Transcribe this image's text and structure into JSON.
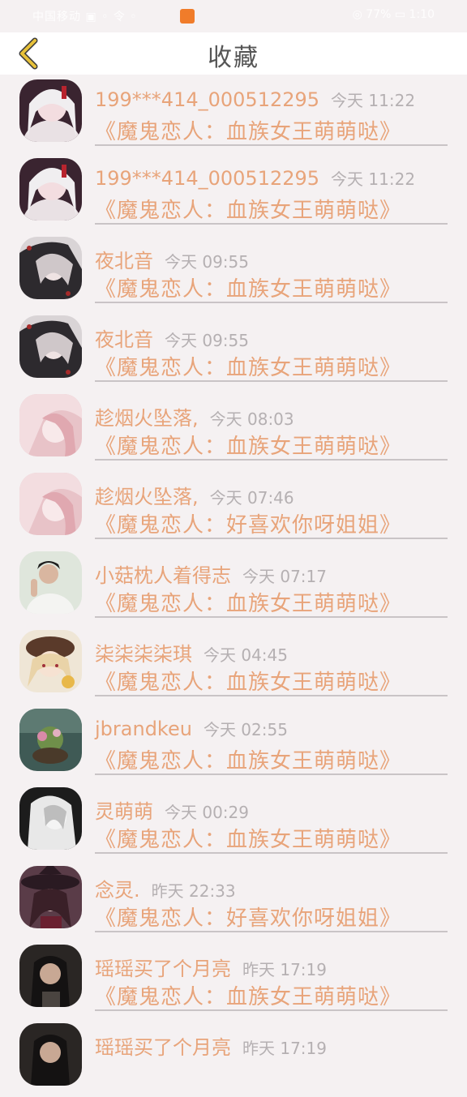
{
  "status_bar": {
    "left_text": "中国移动 ▣ ◦ 令 ◦",
    "right_text": "◎ 77% ▭ 1:10"
  },
  "header": {
    "title": "收藏",
    "back_icon": "chevron-left-icon"
  },
  "colors": {
    "accent": "#e8a47a",
    "back_icon": "#e7c13a",
    "time": "#b5b0b2",
    "divider": "#c9c4c6"
  },
  "items": [
    {
      "name": "199***414_000512295",
      "time": "今天 11:22",
      "title": "《魔鬼恋人：血族女王萌萌哒》",
      "avatar": "girl-white-hair-avatar"
    },
    {
      "name": "199***414_000512295",
      "time": "今天 11:22",
      "title": "《魔鬼恋人：血族女王萌萌哒》",
      "avatar": "girl-white-hair-avatar"
    },
    {
      "name": "夜北音",
      "time": "今天 09:55",
      "title": "《魔鬼恋人：血族女王萌萌哒》",
      "avatar": "girl-dark-avatar"
    },
    {
      "name": "夜北音",
      "time": "今天 09:55",
      "title": "《魔鬼恋人：血族女王萌萌哒》",
      "avatar": "girl-dark-avatar"
    },
    {
      "name": "趁烟火坠落,",
      "time": "今天 08:03",
      "title": "《魔鬼恋人：血族女王萌萌哒》",
      "avatar": "girl-pink-avatar"
    },
    {
      "name": "趁烟火坠落,",
      "time": "今天 07:46",
      "title": "《魔鬼恋人：好喜欢你呀姐姐》",
      "avatar": "girl-pink-avatar"
    },
    {
      "name": "小菇枕人着得志",
      "time": "今天 07:17",
      "title": "《魔鬼恋人：血族女王萌萌哒》",
      "avatar": "boy-photo-avatar"
    },
    {
      "name": "柒柒柒柒琪",
      "time": "今天 04:45",
      "title": "《魔鬼恋人：血族女王萌萌哒》",
      "avatar": "anime-girl-hat-avatar"
    },
    {
      "name": "jbrandkeu",
      "time": "今天 02:55",
      "title": "《魔鬼恋人：血族女王萌萌哒》",
      "avatar": "plant-avatar"
    },
    {
      "name": "灵萌萌",
      "time": "今天 00:29",
      "title": "《魔鬼恋人：血族女王萌萌哒》",
      "avatar": "monochrome-girl-avatar"
    },
    {
      "name": "念灵.",
      "time": "昨天 22:33",
      "title": "《魔鬼恋人：好喜欢你呀姐姐》",
      "avatar": "witch-girl-avatar"
    },
    {
      "name": "瑶瑶买了个月亮",
      "time": "昨天 17:19",
      "title": "《魔鬼恋人：血族女王萌萌哒》",
      "avatar": "dark-photo-avatar"
    },
    {
      "name": "瑶瑶买了个月亮",
      "time": "昨天 17:19",
      "title": "",
      "avatar": "dark-photo-avatar"
    }
  ]
}
